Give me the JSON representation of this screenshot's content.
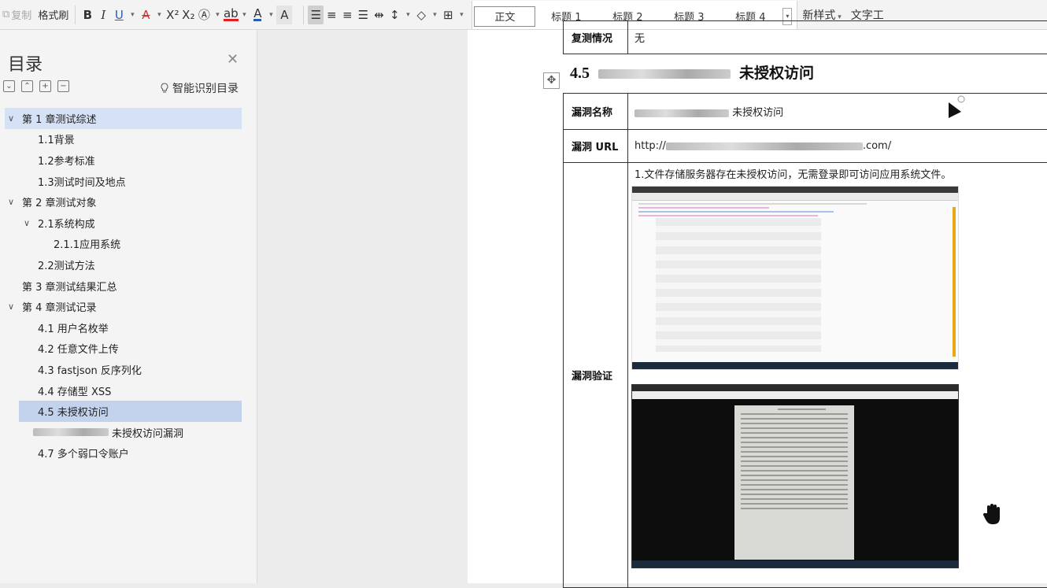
{
  "toolbar": {
    "copy_label": "复制",
    "format_painter_label": "格式刷",
    "styles": [
      "正文",
      "标题 1",
      "标题 2",
      "标题 3",
      "标题 4"
    ],
    "new_style_label": "新样式",
    "word_tools_label": "文字工"
  },
  "nav": {
    "title": "目录",
    "smart_toc_label": "智能识别目录",
    "items": [
      {
        "label": "第 1 章测试综述",
        "level": 0
      },
      {
        "label": "1.1背景",
        "level": 1
      },
      {
        "label": "1.2参考标准",
        "level": 1
      },
      {
        "label": "1.3测试时间及地点",
        "level": 1
      },
      {
        "label": "第 2 章测试对象",
        "level": 0
      },
      {
        "label": "2.1系统构成",
        "level": 1
      },
      {
        "label": "2.1.1应用系统",
        "level": 2
      },
      {
        "label": "2.2测试方法",
        "level": 1
      },
      {
        "label": "第 3 章测试结果汇总",
        "level": 0
      },
      {
        "label": "第 4 章测试记录",
        "level": 0
      },
      {
        "label": "4.1 用户名枚举",
        "level": 1
      },
      {
        "label": "4.2 任意文件上传",
        "level": 1
      },
      {
        "label": "4.3 fastjson 反序列化",
        "level": 1
      },
      {
        "label": "4.4 存储型 XSS",
        "level": 1
      },
      {
        "label": "4.5 未授权访问",
        "level": 1
      },
      {
        "label": "未授权访问漏洞",
        "level": 1
      },
      {
        "label": "4.7 多个弱口令账户",
        "level": 1
      }
    ]
  },
  "document": {
    "top_row_key": "复测情况",
    "top_row_value": "无",
    "heading_num": "4.5",
    "heading_text": "未授权访问",
    "row_name_key": "漏洞名称",
    "row_name_value": "未授权访问",
    "row_url_key": "漏洞 URL",
    "row_url_prefix": "http://",
    "row_url_suffix": ".com/",
    "row_verify_key": "漏洞验证",
    "verify_text": "1.文件存储服务器存在未授权访问，无需登录即可访问应用系统文件。"
  }
}
